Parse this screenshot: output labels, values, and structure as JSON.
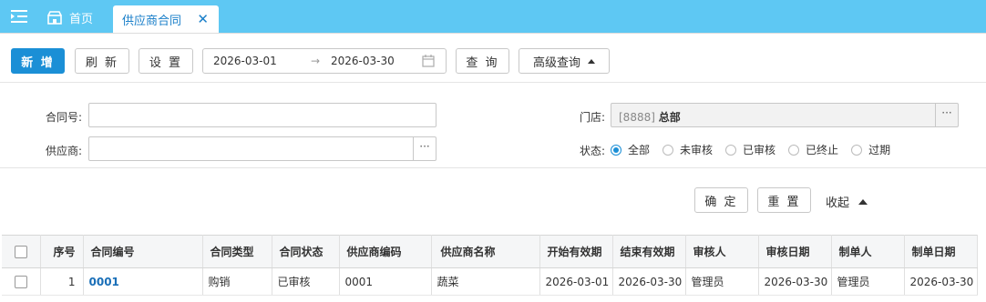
{
  "tabs": {
    "home_label": "首页",
    "active_label": "供应商合同",
    "close_glyph": "✕"
  },
  "toolbar": {
    "add_label": "新 增",
    "refresh_label": "刷 新",
    "settings_label": "设 置",
    "date_from": "2026-03-01",
    "date_arrow": "→",
    "date_to": "2026-03-30",
    "query_label": "查 询",
    "advanced_label": "高级查询"
  },
  "filters": {
    "contract_no_label": "合同号:",
    "contract_no_value": "",
    "supplier_label": "供应商:",
    "supplier_value": "",
    "store_label": "门店:",
    "store_code": "[8888]",
    "store_name": "总部",
    "ellipsis": "···",
    "status_label": "状态:",
    "status_options": [
      "全部",
      "未审核",
      "已审核",
      "已终止",
      "过期"
    ],
    "status_selected": "全部",
    "confirm_label": "确 定",
    "reset_label": "重 置",
    "collapse_label": "收起"
  },
  "table": {
    "columns": [
      "序号",
      "合同编号",
      "合同类型",
      "合同状态",
      "供应商编码",
      "供应商名称",
      "开始有效期",
      "结束有效期",
      "审核人",
      "审核日期",
      "制单人",
      "制单日期"
    ],
    "rows": [
      {
        "seq": "1",
        "contract_no": "0001",
        "type": "购销",
        "status": "已审核",
        "supplier_code": "0001",
        "supplier_name": "蔬菜",
        "start": "2026-03-01",
        "end": "2026-03-30",
        "auditor": "管理员",
        "audit_date": "2026-03-30",
        "creator": "管理员",
        "create_date": "2026-03-30"
      }
    ]
  },
  "colors": {
    "accent": "#1b8fd6",
    "topbar": "#5ec8f3"
  }
}
